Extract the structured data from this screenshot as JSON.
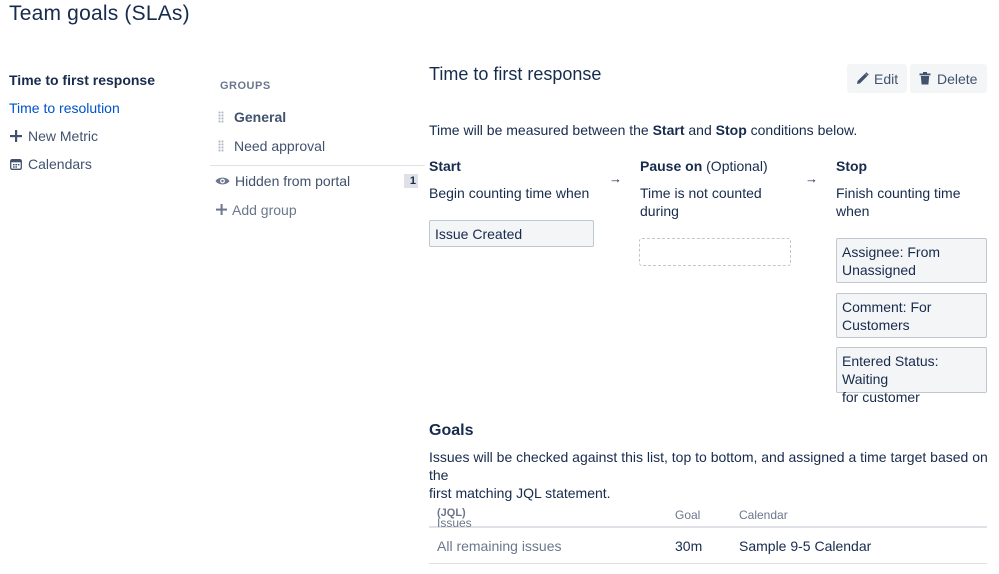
{
  "page": {
    "title": "Team goals (SLAs)"
  },
  "nav": {
    "active_item": "Time to first response",
    "link_item": "Time to resolution",
    "new_metric": "New Metric",
    "calendars": "Calendars"
  },
  "groups": {
    "heading": "GROUPS",
    "items": [
      {
        "label": "General"
      },
      {
        "label": "Need approval"
      }
    ],
    "hidden": {
      "label": "Hidden from portal",
      "count": "1"
    },
    "add_group": "Add group"
  },
  "detail": {
    "title": "Time to first response",
    "edit_label": "Edit",
    "delete_label": "Delete",
    "measure": {
      "prefix": "Time will be measured between the ",
      "start": "Start",
      "and": " and ",
      "stop": "Stop",
      "suffix": " conditions below."
    },
    "start": {
      "heading": "Start",
      "desc": "Begin counting time when",
      "conditions": [
        "Issue Created"
      ]
    },
    "pause": {
      "heading": "Pause on",
      "optional": " (Optional)",
      "desc_line1": "Time is not counted",
      "desc_line2": "during"
    },
    "stop": {
      "heading": "Stop",
      "desc_line1": "Finish counting time",
      "desc_line2": "when",
      "conditions": [
        {
          "line1": "Assignee: From",
          "line2": "Unassigned"
        },
        {
          "line1": "Comment: For",
          "line2": "Customers"
        },
        {
          "line1": "Entered Status: Waiting",
          "line2": "for customer"
        }
      ]
    },
    "arrow": "→",
    "goals": {
      "heading": "Goals",
      "desc_line1": "Issues will be checked against this list, top to bottom, and assigned a time target based on the",
      "desc_line2": "first matching JQL statement.",
      "columns": {
        "issues": "Issues",
        "jql": "(JQL)",
        "goal": "Goal",
        "calendar": "Calendar"
      },
      "rows": [
        {
          "issues": "All remaining issues",
          "goal": "30m",
          "calendar": "Sample 9-5 Calendar"
        }
      ]
    }
  }
}
